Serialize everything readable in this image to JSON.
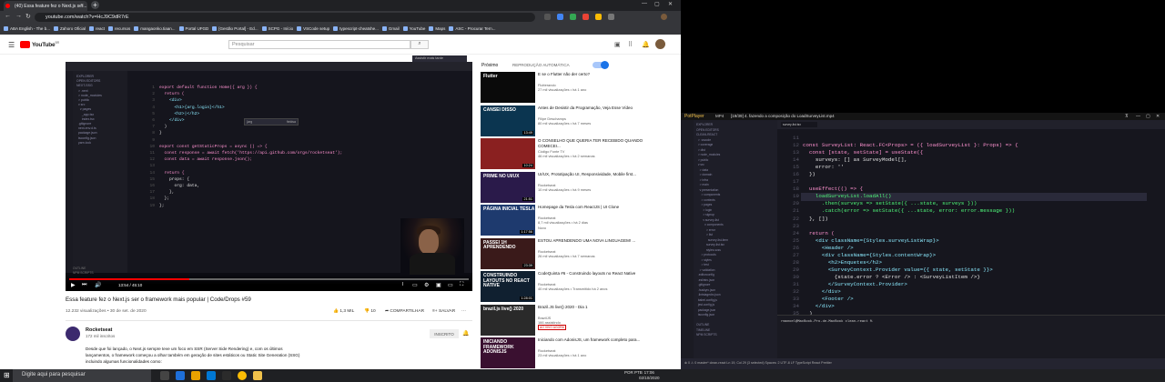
{
  "browser": {
    "tab_title": "(40) Essa feature fez o Next.js ser...",
    "new_tab": "+",
    "url": "youtube.com/watch?v=HcJ9C9dR7rE",
    "bookmarks": [
      "ABA English - The b...",
      "Zahoro Oficial",
      "react",
      "recursos",
      "mangaonko.tiaan...",
      "Portal UFGD",
      "[Gestão Portal] - Ed...",
      "SCPG - Início",
      "VSCode setup",
      "typescript-cheatshe...",
      "Gmail",
      "YouTube",
      "Maps",
      "ASC - Procurar Tern..."
    ]
  },
  "youtube": {
    "logo_text": "YouTube",
    "logo_country": "BR",
    "search_placeholder": "Pesquisar",
    "video": {
      "title": "Essa feature fez o Next.js ser o framework mais popular | Code/Drops #59",
      "meta": "12.232 visualizações • 30 de set. de 2020",
      "likes": "1,3 MIL",
      "dislikes": "10",
      "share": "COMPARTILHAR",
      "save": "SALVAR",
      "time": "13:54 / 45:10",
      "progress_fraction": 0.3,
      "overlay_btn": "Assistir mais tarde"
    },
    "channel": {
      "name": "Rocketseat",
      "subs": "172 mil inscritos",
      "join": "INSCRITO",
      "description": "Desde que foi lançado, o Next.js sempre teve um foco em SSR (Server Side Rendering) e, com os últimos lançamentos, o framework começou a olhar também em geração de sites estáticos ou Static Site Generation (SSG) incluindo algumas funcionalidades como:"
    },
    "next_label": "Próximo",
    "autoplay_label": "REPRODUÇÃO AUTOMÁTICA",
    "recommendations": [
      {
        "title": "E se o Flutter não der certo?",
        "channel": "Flutterando",
        "meta": "27 mil visualizações • há 1 ano",
        "thumb_text": "Flutter",
        "color": "#0a0a0a",
        "duration": ""
      },
      {
        "title": "Antes de Desistir da Programação, Veja Esse Vídeo",
        "channel": "Filipe Deschamps",
        "meta": "80 mil visualizações • há 7 meses",
        "thumb_text": "CANSEI DISSO",
        "color": "#0b3550",
        "duration": "13:49"
      },
      {
        "title": "O CONSELHO QUE QUERIA TER RECEBIDO QUANDO COMECEI...",
        "channel": "Código Fonte TV",
        "meta": "46 mil visualizações • há 2 semanas",
        "thumb_text": "",
        "color": "#8a2020",
        "duration": "10:24"
      },
      {
        "title": "UI/UX, Prototipação UI, Responsividade, Mobile first...",
        "channel": "Rocketseat",
        "meta": "10 mil visualizações • há 9 meses",
        "thumb_text": "PRIME NO UI/UX",
        "color": "#2a1a4a",
        "duration": "21:51"
      },
      {
        "title": "Homepage da Tesla com ReactJS | UI Clone",
        "channel": "Rocketseat",
        "meta": "8,7 mil visualizações • há 2 dias",
        "thumb_text": "PÁGINA INICIAL TESLA",
        "color": "#1e3a6e",
        "duration": "1:17:56",
        "badge": "Novo"
      },
      {
        "title": "ESTOU APRENDENDO UMA NOVA LINGUAGEM! ...",
        "channel": "Rocketseat",
        "meta": "26 mil visualizações • há 7 semanas",
        "thumb_text": "PASSEI 1H APRENDENDO",
        "color": "#3a1a1a",
        "duration": "23:39"
      },
      {
        "title": "CodeQuinta #6 - Construindo layouts no React Native",
        "channel": "Rocketseat",
        "meta": "40 mil visualizações • Transmitido há 2 anos",
        "thumb_text": "CONSTRUINDO LAYOUTS NO REACT NATIVE",
        "color": "#102030",
        "duration": "1:28:01"
      },
      {
        "title": "Brazil.JS live() 2020 - Dia 1",
        "channel": "BrazilJS",
        "meta": "166 assistindo",
        "thumb_text": "brazil.js live() 2020",
        "color": "#2a2a2a",
        "duration": "",
        "live": "AO VIVO AGORA"
      },
      {
        "title": "Iniciando com AdonisJS, um framework completo para...",
        "channel": "Rocketseat",
        "meta": "23 mil visualizações • há 1 ano",
        "thumb_text": "INICIANDO FRAMEWORK ADONISJS",
        "color": "#3a1030",
        "duration": ""
      }
    ]
  },
  "video_editor": {
    "code_lines": [
      "export default function Home({ arg }) {",
      "  return (",
      "    <div>",
      "      <h1>{arg.login}</h1>",
      "      <h2>|</h2>",
      "    </div>",
      "  )",
      "}",
      "",
      "export const getStaticProps = async () => {",
      "  const response = await fetch('https://api.github.com/orgs/rocketseat');",
      "  const data = await response.json();",
      "",
      "  return {",
      "    props: {",
      "      org: data,",
      "    },",
      "  };",
      "};"
    ],
    "line_numbers": [
      "1",
      "2",
      "3",
      "4",
      "5",
      "6",
      "7",
      "8",
      "9",
      "10",
      "11",
      "12",
      "13",
      "14",
      "15",
      "16",
      "17",
      "18",
      "19"
    ],
    "popup": "{arg",
    "popup_hint": "fieldsa",
    "tree": [
      "EXPLORER",
      "OPEN EDITORS",
      "NEXT-SSG",
      "  > .next",
      "  > node_modules",
      "  > public",
      "  v src",
      "    v pages",
      "      _app.tsx",
      "      index.tsx",
      "  .gitignore",
      "  next-env.d.ts",
      "  package.json",
      "  tsconfig.json",
      "  yarn.lock"
    ],
    "bottom": [
      "OUTLINE",
      "NPM SCRIPTS"
    ]
  },
  "potplayer": {
    "brand": "PotPlayer",
    "menu": "MP4",
    "file_title": "[19/39] 4. fazendo a composição do LoadSurveyList.mp4",
    "tree": [
      "EXPLORER",
      "OPEN EDITORS",
      "CLEAN-REACT",
      "  > .vscode",
      "  > coverage",
      "  > dist",
      "  > node_modules",
      "  > public",
      "  v src",
      "    > data",
      "    > domain",
      "    > infra",
      "    > main",
      "    v presentation",
      "      > components",
      "      > contexts",
      "      > pages",
      "        > login",
      "        > signup",
      "        v survey-list",
      "          v components",
      "            > error",
      "            > list",
      "              survey-list-item",
      "            survey-list.tsx",
      "            styles.scss",
      "      > protocols",
      "      > styles",
      "      > test",
      "    > validation",
      "  .editorconfig",
      "  .eslintrc.json",
      "  .gitignore",
      "  .huskyrc.json",
      "  .lintstagedrc.json",
      "  babel.config.js",
      "  jest.config.js",
      "  package.json",
      "  tsconfig.json",
      "",
      "OUTLINE",
      "TIMELINE",
      "NPM SCRIPTS"
    ],
    "code_lines": [
      "",
      "const SurveyList: React.FC<Props> = ({ loadSurveyList }: Props) => {",
      "  const [state, setState] = useState({",
      "    surveys: [] as SurveyModel[],",
      "    error: ''",
      "  })",
      "",
      "  useEffect(() => {",
      "    loadSurveyList.loadAll()",
      "      .then(surveys => setState({ ...state, surveys }))",
      "      .catch(error => setState({ ...state, error: error.message }))",
      "  }, [])",
      "",
      "  return (",
      "    <div className={Styles.surveyListWrap}>",
      "      <Header />",
      "      <div className={Styles.contentWrap}>",
      "        <h2>Enquetes</h2>",
      "        <SurveyContext.Provider value={{ state, setState }}>",
      "          {state.error ? <Error /> : <SurveyListItem />}",
      "        </SurveyContext.Provider>",
      "      </div>",
      "      <Footer />",
      "    </div>",
      "  )"
    ],
    "line_numbers": [
      "11",
      "12",
      "13",
      "14",
      "15",
      "16",
      "17",
      "18",
      "19",
      "20",
      "21",
      "22",
      "23",
      "24",
      "25",
      "26",
      "27",
      "28",
      "29",
      "30",
      "31",
      "32",
      "33",
      "34",
      "35"
    ],
    "terminal": "rmanoel@MacBook-Pro-de-MacBook clean-react %",
    "status": "⊗ 0 ⚠ 0   master*   clean-react   Ln 19, Col 29 (3 selected)   Spaces: 2   UTF-8   LF   TypeScript React   Prettier"
  },
  "taskbar": {
    "search": "Digite aqui para pesquisar",
    "lang": "POR PTB",
    "time": "17:06",
    "date": "02/10/2020"
  }
}
